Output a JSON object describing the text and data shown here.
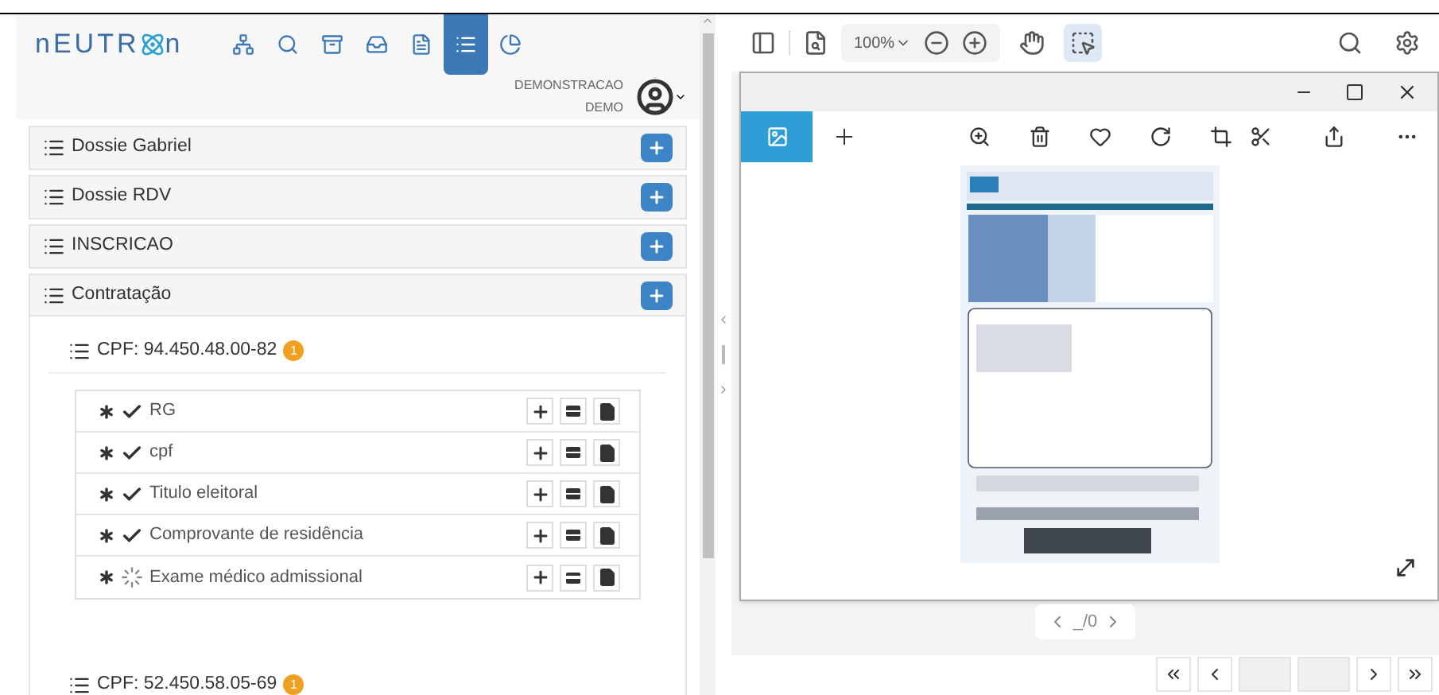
{
  "app": {
    "logo_start": "nEUTR",
    "logo_end": "n",
    "nav": [
      {
        "kind": "sitemap",
        "selected": false
      },
      {
        "kind": "search",
        "selected": false
      },
      {
        "kind": "archive",
        "selected": false
      },
      {
        "kind": "inbox",
        "selected": false
      },
      {
        "kind": "file",
        "selected": false
      },
      {
        "kind": "list",
        "selected": true
      },
      {
        "kind": "pie",
        "selected": false
      }
    ],
    "user": {
      "company": "DEMONSTRACAO",
      "name": "DEMO"
    },
    "sections": [
      {
        "title": "Dossie Gabriel",
        "expanded": false
      },
      {
        "title": "Dossie RDV",
        "expanded": false
      },
      {
        "title": "INSCRICAO",
        "expanded": false
      },
      {
        "title": "Contratação",
        "expanded": true,
        "groups": [
          {
            "title": "CPF: 94.450.48.00-82",
            "badge": "1",
            "documents": [
              {
                "name": "RG",
                "verified": true
              },
              {
                "name": "cpf",
                "verified": true
              },
              {
                "name": "Titulo eleitoral",
                "verified": true
              },
              {
                "name": "Comprovante de residência",
                "verified": true
              },
              {
                "name": "Exame médico admissional",
                "verified": false
              }
            ]
          },
          {
            "title": "CPF: 52.450.58.05-69",
            "badge": "1"
          }
        ]
      }
    ]
  },
  "viewer": {
    "zoom": "100%",
    "tools": [
      {
        "kind": "hand",
        "selected": false
      },
      {
        "kind": "select",
        "selected": true
      }
    ],
    "photos": {
      "tools": [
        {
          "kind": "zoom"
        },
        {
          "kind": "trash"
        },
        {
          "kind": "heart"
        },
        {
          "kind": "rotate"
        },
        {
          "kind": "crop"
        }
      ],
      "page": "_/0"
    },
    "pagination": [
      {
        "kind": "first"
      },
      {
        "kind": "prev"
      },
      {
        "kind": "blank"
      },
      {
        "kind": "blank"
      },
      {
        "kind": "next"
      },
      {
        "kind": "last"
      }
    ]
  }
}
